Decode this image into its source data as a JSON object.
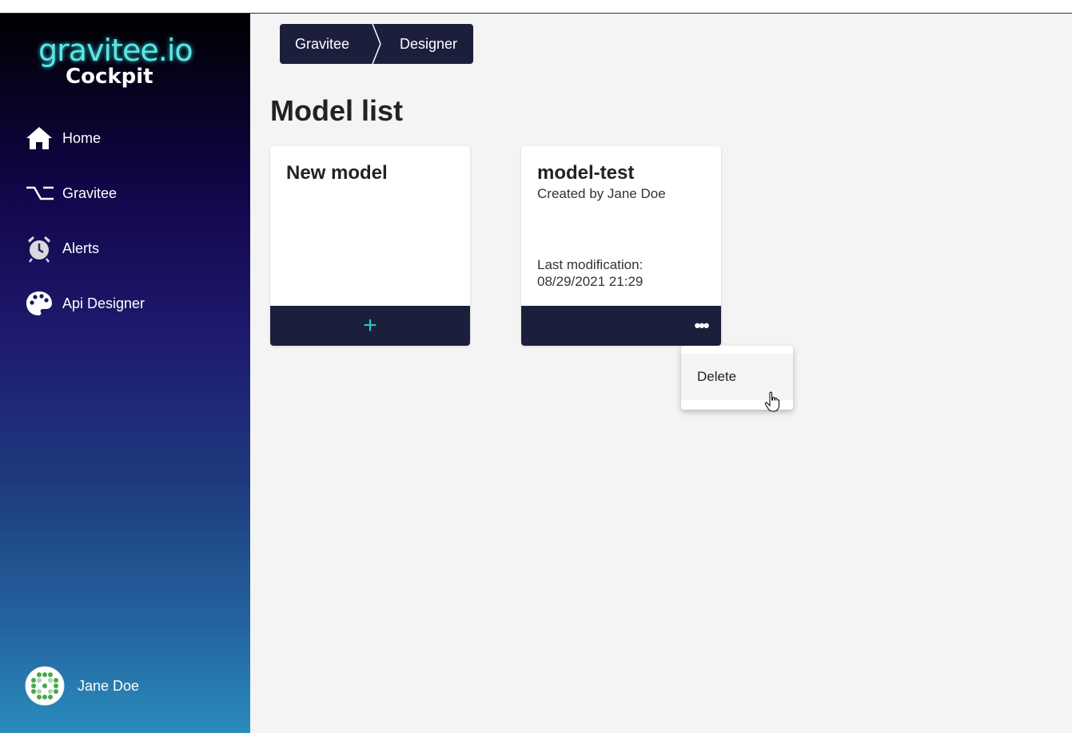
{
  "brand": {
    "logo_top": "gravitee.io",
    "logo_bottom": "Cockpit"
  },
  "sidebar": {
    "items": [
      {
        "label": "Home",
        "icon": "home-icon"
      },
      {
        "label": "Gravitee",
        "icon": "gravitee-icon"
      },
      {
        "label": "Alerts",
        "icon": "alarm-clock-icon"
      },
      {
        "label": "Api Designer",
        "icon": "palette-icon"
      }
    ]
  },
  "user": {
    "name": "Jane Doe"
  },
  "breadcrumb": {
    "items": [
      "Gravitee",
      "Designer"
    ]
  },
  "page": {
    "title": "Model list"
  },
  "cards": {
    "new_model": {
      "title": "New model",
      "action": "+"
    },
    "model": {
      "title": "model-test",
      "created_by": "Created by Jane Doe",
      "last_modification_label": "Last modification:",
      "last_modification_value": "08/29/2021 21:29",
      "more": "•••"
    }
  },
  "context_menu": {
    "items": [
      "Delete"
    ]
  },
  "colors": {
    "accent": "#2bc4c4",
    "dark": "#1c1f3c",
    "background": "#f4f4f4"
  }
}
